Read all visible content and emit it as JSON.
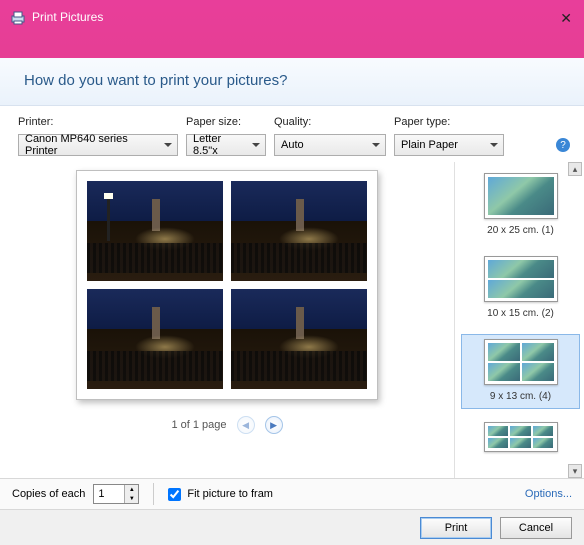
{
  "titlebar": {
    "title": "Print Pictures"
  },
  "header": {
    "question": "How do you want to print your pictures?"
  },
  "filters": {
    "printer": {
      "label": "Printer:",
      "value": "Canon MP640 series Printer"
    },
    "paper_size": {
      "label": "Paper size:",
      "value": "Letter 8.5\"x"
    },
    "quality": {
      "label": "Quality:",
      "value": "Auto"
    },
    "paper_type": {
      "label": "Paper type:",
      "value": "Plain Paper"
    }
  },
  "help_icon": "?",
  "pager": {
    "text": "1 of 1 page"
  },
  "templates": [
    {
      "id": "20x25",
      "label": "20 x 25 cm. (1)",
      "cells": 1
    },
    {
      "id": "10x15",
      "label": "10 x 15 cm. (2)",
      "cells": 2
    },
    {
      "id": "9x13",
      "label": "9 x 13 cm. (4)",
      "cells": 4,
      "selected": true
    },
    {
      "id": "more",
      "label": "",
      "cells": 6
    }
  ],
  "bottombar": {
    "copies_label": "Copies of each",
    "copies_value": "1",
    "fit_label": "Fit picture to fram",
    "fit_checked": true,
    "options": "Options..."
  },
  "buttons": {
    "print": "Print",
    "cancel": "Cancel"
  }
}
